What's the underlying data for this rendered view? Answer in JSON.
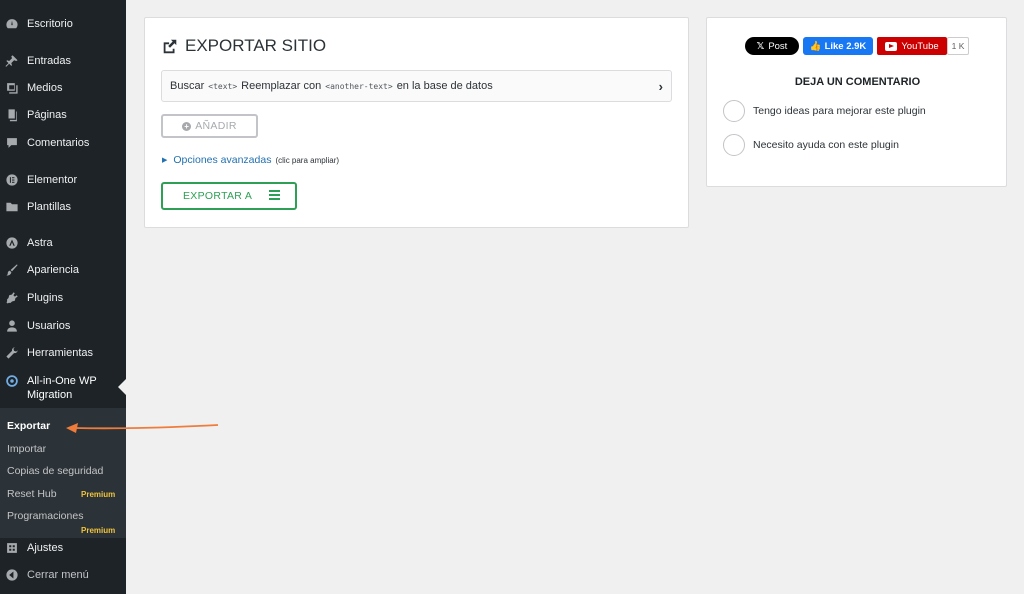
{
  "sidebar": {
    "items": [
      {
        "label": "Escritorio",
        "icon": "dashboard-icon"
      },
      {
        "label": "Entradas",
        "icon": "pin-icon"
      },
      {
        "label": "Medios",
        "icon": "media-icon"
      },
      {
        "label": "Páginas",
        "icon": "pages-icon"
      },
      {
        "label": "Comentarios",
        "icon": "comments-icon"
      },
      {
        "label": "Elementor",
        "icon": "elementor-icon"
      },
      {
        "label": "Plantillas",
        "icon": "folder-icon"
      },
      {
        "label": "Astra",
        "icon": "astra-icon"
      },
      {
        "label": "Apariencia",
        "icon": "brush-icon"
      },
      {
        "label": "Plugins",
        "icon": "plugin-icon"
      },
      {
        "label": "Usuarios",
        "icon": "users-icon"
      },
      {
        "label": "Herramientas",
        "icon": "wrench-icon"
      }
    ],
    "active": {
      "label_line1": "All-in-One WP",
      "label_line2": "Migration",
      "icon": "migration-icon"
    },
    "submenu": [
      {
        "label": "Exportar",
        "current": true
      },
      {
        "label": "Importar"
      },
      {
        "label": "Copias de seguridad"
      },
      {
        "label": "Reset Hub",
        "badge": "Premium"
      },
      {
        "label": "Programaciones",
        "badge": "Premium"
      }
    ],
    "bottom": [
      {
        "label": "Ajustes",
        "icon": "settings-icon"
      },
      {
        "label": "Cerrar menú",
        "icon": "collapse-icon"
      }
    ]
  },
  "export": {
    "title": "EXPORTAR SITIO",
    "search_replace": {
      "prefix": "Buscar",
      "code1": "<text>",
      "middle": "Reemplazar con",
      "code2": "<another-text>",
      "suffix": "en la base de datos"
    },
    "add_button": "AÑADIR",
    "advanced_link": "Opciones avanzadas",
    "advanced_hint": "(clic para ampliar)",
    "export_button": "EXPORTAR A"
  },
  "social": {
    "x_post": "Post",
    "fb_like": "Like 2.9K",
    "youtube": "YouTube",
    "youtube_count": "1 K"
  },
  "feedback": {
    "title": "DEJA UN COMENTARIO",
    "options": [
      "Tengo ideas para mejorar este plugin",
      "Necesito ayuda con este plugin"
    ]
  },
  "colors": {
    "sidebar_bg": "#1d2327",
    "submenu_bg": "#2c3338",
    "accent_green": "#2ea055",
    "link_blue": "#2271b1",
    "premium_yellow": "#f0c33c",
    "annotation_arrow": "#f07c3c"
  }
}
